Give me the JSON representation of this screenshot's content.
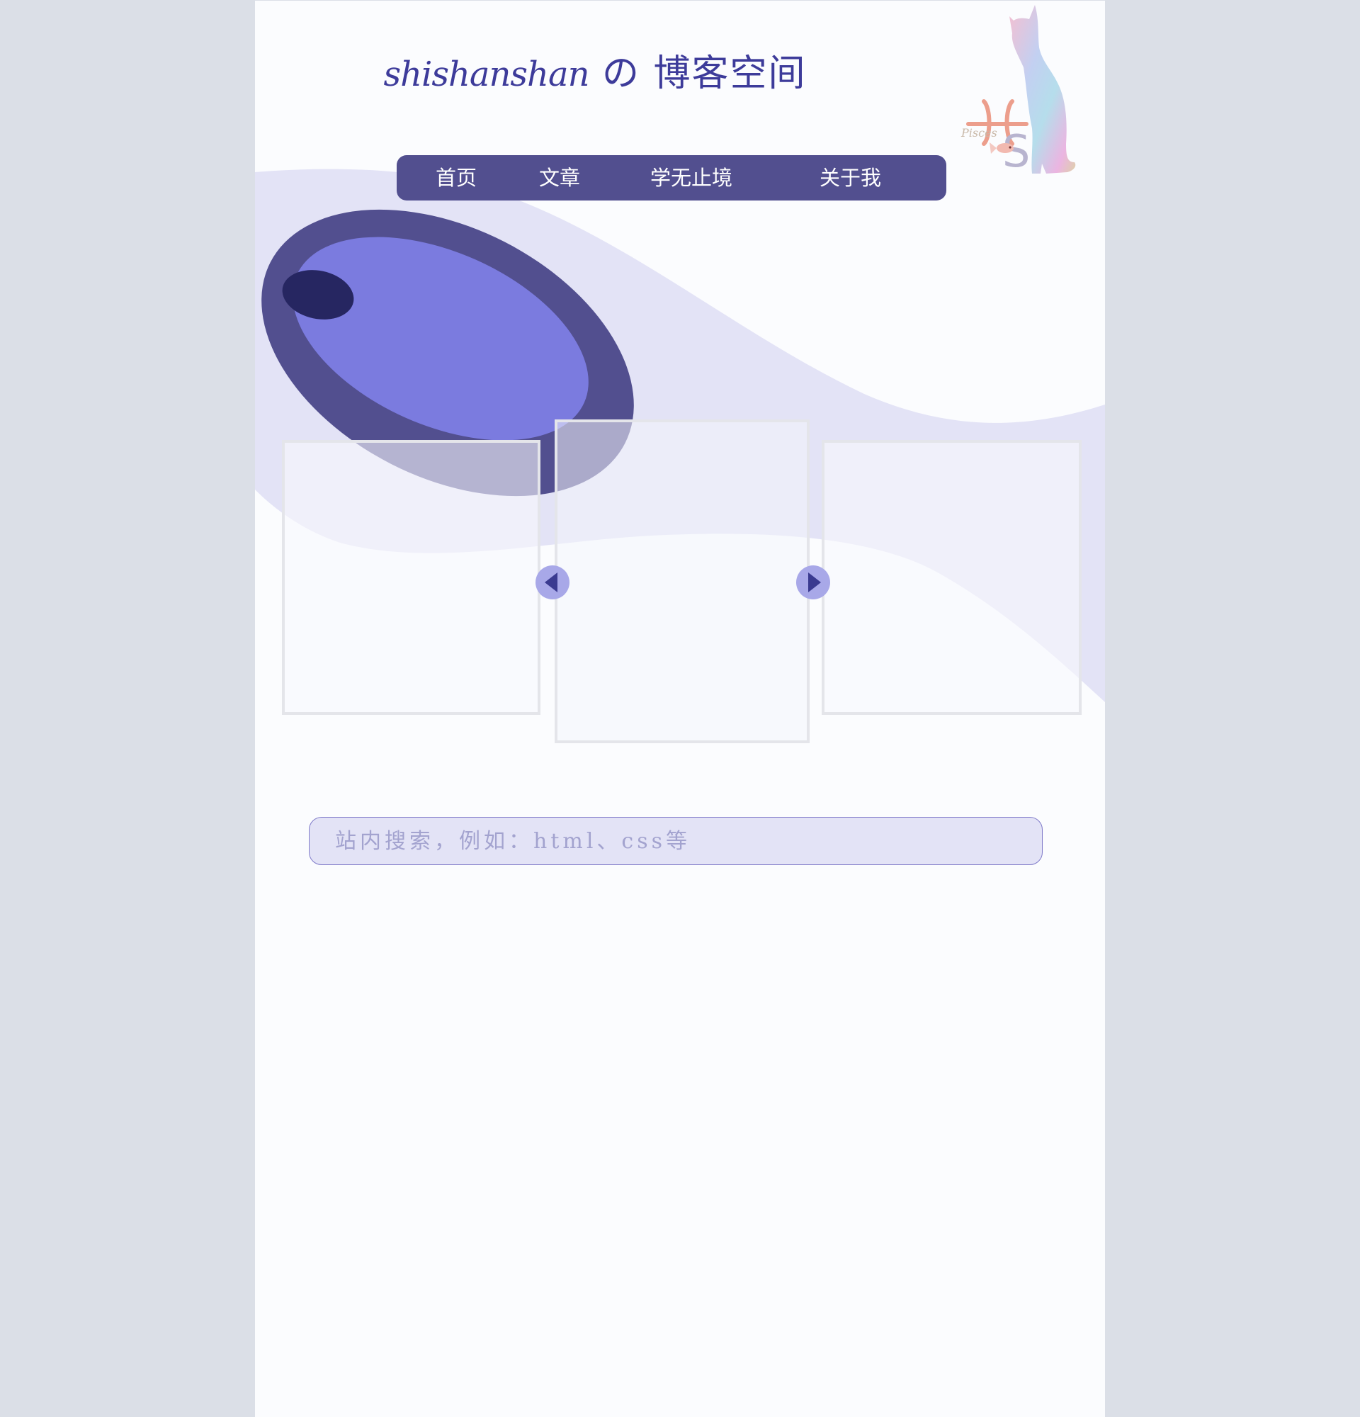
{
  "header": {
    "title_latin": "shishanshan",
    "title_cjk": "の 博客空间"
  },
  "nav": {
    "items": [
      {
        "label": "首页"
      },
      {
        "label": "文章"
      },
      {
        "label": "学无止境"
      },
      {
        "label": "关于我"
      }
    ]
  },
  "logo": {
    "text": "Pisces",
    "monogram": "S",
    "icon": "cat-silhouette-icon"
  },
  "carousel": {
    "prev_icon": "chevron-left-icon",
    "next_icon": "chevron-right-icon"
  },
  "search": {
    "placeholder": "站内搜索，例如：html、css等",
    "value": ""
  },
  "colors": {
    "page_bg": "#dbdfe7",
    "content_bg": "#fbfcfe",
    "nav_bg": "#524f8f",
    "accent_dark": "#3d3b9a",
    "ellipse_outer": "#524f8f",
    "ellipse_inner": "#7b7bdf",
    "ellipse_eye": "#262661",
    "wave": "#e3e3f6",
    "search_border": "#7f7ac9"
  }
}
